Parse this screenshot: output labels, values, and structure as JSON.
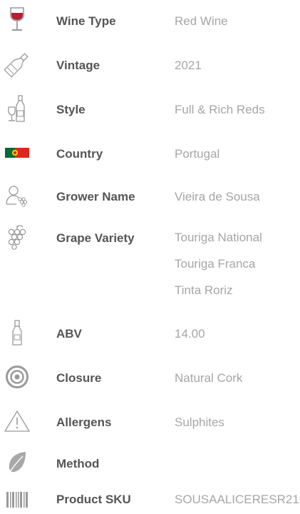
{
  "specs": {
    "wine_type": {
      "label": "Wine Type",
      "value": "Red Wine",
      "icon": "wine-glass-icon"
    },
    "vintage": {
      "label": "Vintage",
      "value": "2021",
      "icon": "bottle-outline-icon"
    },
    "style": {
      "label": "Style",
      "value": "Full & Rich Reds",
      "icon": "bottle-and-glass-icon"
    },
    "country": {
      "label": "Country",
      "value": "Portugal",
      "icon": "portugal-flag-icon"
    },
    "grower": {
      "label": "Grower Name",
      "value": "Vieira de Sousa",
      "icon": "grower-icon"
    },
    "grape": {
      "label": "Grape Variety",
      "values": [
        "Touriga National",
        "Touriga Franca",
        "Tinta Roriz"
      ],
      "icon": "grapes-icon"
    },
    "abv": {
      "label": "ABV",
      "value": "14.00",
      "icon": "bottle-icon"
    },
    "closure": {
      "label": "Closure",
      "value": "Natural Cork",
      "icon": "target-icon"
    },
    "allergens": {
      "label": "Allergens",
      "value": "Sulphites",
      "icon": "warning-icon"
    },
    "method": {
      "label": "Method",
      "value": "",
      "icon": "leaf-icon"
    },
    "sku": {
      "label": "Product SKU",
      "value": "SOUSAALICERESR21",
      "icon": "barcode-icon"
    }
  },
  "colors": {
    "label": "#555555",
    "value": "#a6a6a6",
    "icon": "#9a9a9a",
    "wine_red": "#b22234",
    "flag_green": "#046a38",
    "flag_red": "#da291c"
  }
}
